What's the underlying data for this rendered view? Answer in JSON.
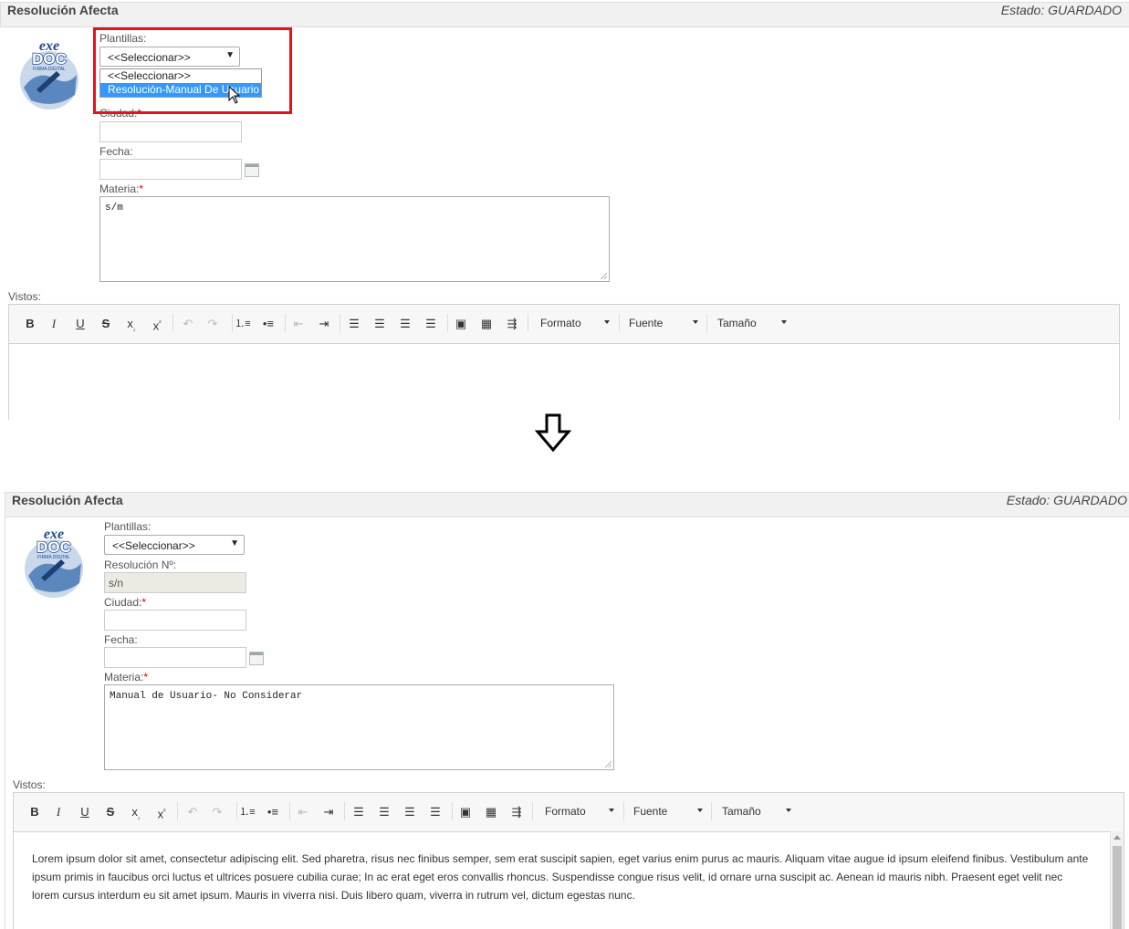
{
  "before": {
    "header": {
      "title": "Resolución Afecta",
      "status": "Estado: GUARDADO"
    },
    "logo": {
      "line1": "exe",
      "line2": "DOC",
      "subtitle": "FIRMA DIGITAL"
    },
    "plantillas": {
      "label": "Plantillas:",
      "selected": "<<Seleccionar>>",
      "options": [
        "<<Seleccionar>>",
        "Resolución-Manual De Usuario"
      ],
      "highlighted_index": 1
    },
    "ciudad": {
      "label": "Ciudad:",
      "required": "*",
      "value": ""
    },
    "fecha": {
      "label": "Fecha:",
      "value": ""
    },
    "materia": {
      "label": "Materia:",
      "required": "*",
      "value": "s/m"
    },
    "vistos": {
      "label": "Vistos:"
    },
    "toolbar": {
      "format_label": "Formato",
      "font_label": "Fuente",
      "size_label": "Tamaño"
    }
  },
  "after": {
    "header": {
      "title": "Resolución Afecta",
      "status": "Estado: GUARDADO"
    },
    "logo": {
      "line1": "exe",
      "line2": "DOC",
      "subtitle": "FIRMA DIGITAL"
    },
    "plantillas": {
      "label": "Plantillas:",
      "selected": "<<Seleccionar>>"
    },
    "resolucion": {
      "label": "Resolución Nº:",
      "value": "s/n"
    },
    "ciudad": {
      "label": "Ciudad:",
      "required": "*",
      "value": ""
    },
    "fecha": {
      "label": "Fecha:",
      "value": ""
    },
    "materia": {
      "label": "Materia:",
      "required": "*",
      "value": "Manual de Usuario- No Considerar"
    },
    "vistos": {
      "label": "Vistos:",
      "paragraph1": "Lorem ipsum dolor sit amet, consectetur adipiscing elit. Sed pharetra, risus nec finibus semper, sem erat suscipit sapien, eget varius enim purus ac mauris. Aliquam vitae augue id ipsum eleifend finibus. Vestibulum ante ipsum primis in faucibus orci luctus et ultrices posuere cubilia curae; In ac erat eget eros convallis rhoncus. Suspendisse congue risus velit, id ornare urna suscipit ac. Aenean id mauris nibh. Praesent eget velit nec lorem cursus interdum eu sit amet ipsum. Mauris in viverra nisi. Duis libero quam, viverra in rutrum vel, dictum egestas nunc."
    },
    "toolbar": {
      "format_label": "Formato",
      "font_label": "Fuente",
      "size_label": "Tamaño"
    }
  },
  "colors": {
    "highlight": "#3399ff",
    "annotation_box": "#e2141b",
    "required": "#dd0000"
  }
}
